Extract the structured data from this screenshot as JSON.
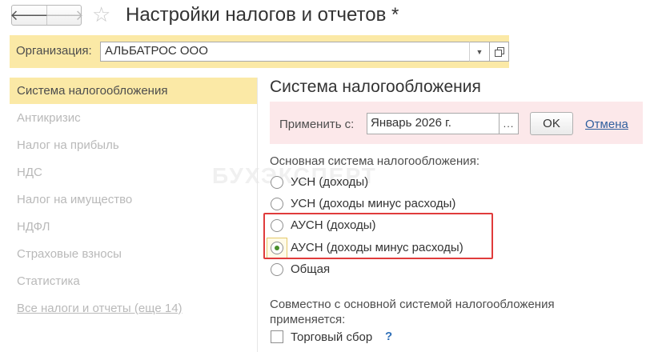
{
  "window": {
    "title": "Настройки налогов и отчетов *"
  },
  "organization": {
    "label": "Организация:",
    "value": "АЛЬБАТРОС ООО"
  },
  "sidebar": {
    "items": [
      {
        "label": "Система налогообложения",
        "active": true
      },
      {
        "label": "Антикризис"
      },
      {
        "label": "Налог на прибыль"
      },
      {
        "label": "НДС"
      },
      {
        "label": "Налог на имущество"
      },
      {
        "label": "НДФЛ"
      },
      {
        "label": "Страховые взносы"
      },
      {
        "label": "Статистика"
      },
      {
        "label": "Все налоги и отчеты (еще 14)",
        "link": true
      }
    ]
  },
  "main": {
    "title": "Система налогообложения",
    "apply": {
      "label": "Применить с:",
      "value": "Январь 2026 г.",
      "picker": "...",
      "ok_label": "OK",
      "cancel_label": "Отмена"
    },
    "tax_system": {
      "label": "Основная система налогообложения:",
      "options": [
        {
          "label": "УСН (доходы)",
          "selected": false
        },
        {
          "label": "УСН (доходы минус расходы)",
          "selected": false
        },
        {
          "label": "АУСН (доходы)",
          "selected": false
        },
        {
          "label": "АУСН (доходы минус расходы)",
          "selected": true
        },
        {
          "label": "Общая",
          "selected": false
        }
      ]
    },
    "combined": {
      "label": "Совместно с основной системой налогообложения применяется:",
      "trade_fee_label": "Торговый сбор",
      "trade_fee_checked": false,
      "help": "?"
    }
  },
  "watermark": "БУХЭКСПЕРТ",
  "colors": {
    "org_bar": "#fbe9a6",
    "sidebar_active": "#fbe9a6",
    "apply_bar": "#fce8ea",
    "link": "#2f5f9e",
    "highlight_border": "#e03b3b",
    "radio_selected": "#4a8f2c"
  },
  "icons": [
    "back-arrow-icon",
    "forward-arrow-icon",
    "star-icon",
    "dropdown-icon",
    "open-icon",
    "help-icon"
  ]
}
